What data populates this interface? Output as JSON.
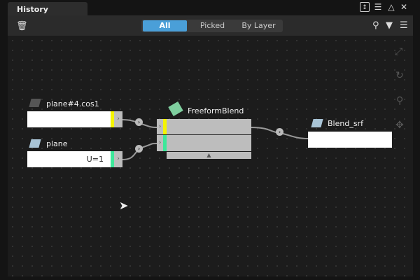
{
  "window": {
    "title": "History Visualizer"
  },
  "toolbar": {
    "filters": [
      "All",
      "Picked",
      "By Layer"
    ],
    "selected": "All"
  },
  "nodes": {
    "input1": {
      "label": "plane#4.cos1",
      "value": ""
    },
    "input2": {
      "label": "plane",
      "value": "U=1"
    },
    "op": {
      "label": "FreeformBlend"
    },
    "output": {
      "label": "Blend_srf"
    }
  },
  "colors": {
    "accent": "#4a9fd8",
    "port_yellow": "#f5f500",
    "port_green": "#3de89a"
  }
}
